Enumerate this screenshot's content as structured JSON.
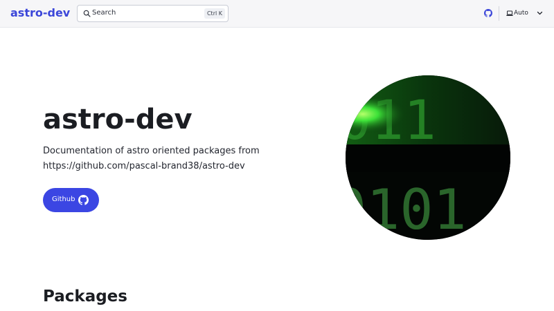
{
  "header": {
    "brand": "astro-dev",
    "search": {
      "placeholder": "Search",
      "shortcut": "Ctrl K"
    },
    "theme_select": {
      "value": "Auto"
    },
    "icons": {
      "github": "github-icon",
      "laptop": "laptop-icon",
      "chevron": "chevron-down-icon",
      "search": "search-icon"
    }
  },
  "hero": {
    "title": "astro-dev",
    "tagline": "Documentation of astro oriented packages from https://github.com/pascal-brand38/astro-dev",
    "button_label": "Github",
    "image": {
      "text_top": "011",
      "text_bottom": "0101"
    }
  },
  "sections": {
    "packages_title": "Packages"
  },
  "colors": {
    "accent": "#3b46e3",
    "brand": "#3b46d9",
    "header_bg": "#f6f6f8"
  }
}
